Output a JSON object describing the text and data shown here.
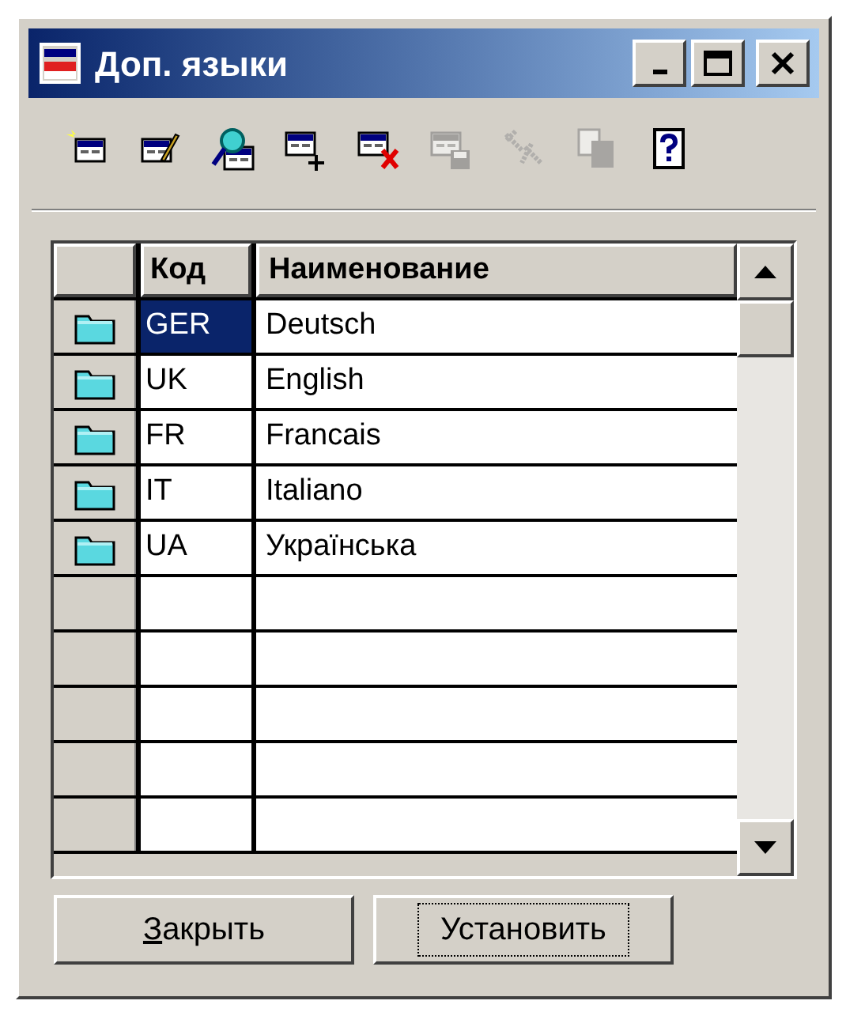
{
  "window": {
    "title": "Доп. языки",
    "controls": [
      {
        "kind": "minimize"
      },
      {
        "kind": "maximize"
      },
      {
        "kind": "close"
      }
    ]
  },
  "toolbar": [
    {
      "kind": "add",
      "disabled": false
    },
    {
      "kind": "edit",
      "disabled": false
    },
    {
      "kind": "find",
      "disabled": false
    },
    {
      "kind": "new-row",
      "disabled": false
    },
    {
      "kind": "delete",
      "disabled": false
    },
    {
      "kind": "save",
      "disabled": true
    },
    {
      "kind": "tools",
      "disabled": true
    },
    {
      "kind": "copy",
      "disabled": true
    },
    {
      "kind": "help",
      "disabled": false
    }
  ],
  "table": {
    "columns": [
      "Код",
      "Наименование"
    ],
    "rows": [
      {
        "code": "GER",
        "name": "Deutsch",
        "selected": true
      },
      {
        "code": "UK",
        "name": "English",
        "selected": false
      },
      {
        "code": "FR",
        "name": "Francais",
        "selected": false
      },
      {
        "code": "IT",
        "name": "Italiano",
        "selected": false
      },
      {
        "code": "UA",
        "name": "Українська",
        "selected": false
      }
    ]
  },
  "buttons": [
    {
      "label": "Закрыть",
      "mnemonic": true,
      "focused": false
    },
    {
      "label": "Установить",
      "mnemonic": false,
      "focused": true
    }
  ]
}
